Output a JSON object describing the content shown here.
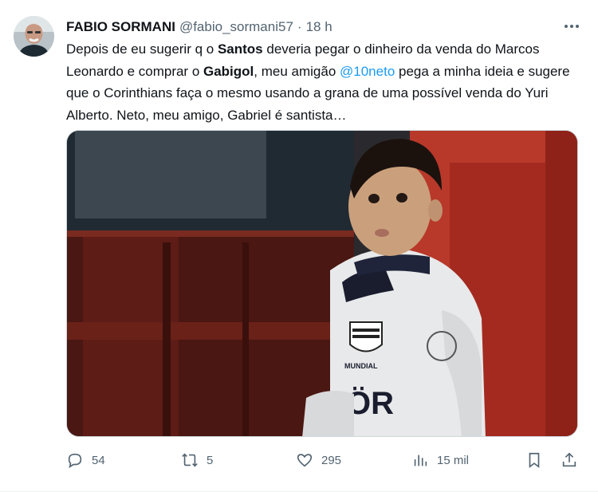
{
  "author": {
    "name": "FABIO SORMANI",
    "handle": "@fabio_sormani57",
    "separator": "·",
    "time": "18 h"
  },
  "tweet": {
    "segments": [
      {
        "t": "Depois de eu sugerir q o ",
        "style": "normal"
      },
      {
        "t": "Santos",
        "style": "bold"
      },
      {
        "t": " deveria pegar o dinheiro da venda do Marcos Leonardo e comprar o ",
        "style": "normal"
      },
      {
        "t": "Gabigol",
        "style": "bold"
      },
      {
        "t": ", meu amigão ",
        "style": "normal"
      },
      {
        "t": "@10neto",
        "style": "mention"
      },
      {
        "t": " pega a minha ideia e sugere que o Corinthians faça o mesmo usando a grana de uma possível venda do Yuri Alberto. Neto, meu amigo, Gabriel é santista…",
        "style": "normal"
      }
    ]
  },
  "media": {
    "shirt_text_mundial": "MUNDIAL",
    "shirt_text_sponsor": "ÖR"
  },
  "actions": {
    "replies": "54",
    "retweets": "5",
    "likes": "295",
    "views": "15 mil"
  },
  "icons": {
    "more": "more-horizontal-icon",
    "reply": "reply-icon",
    "retweet": "retweet-icon",
    "like": "heart-icon",
    "views": "views-chart-icon",
    "bookmark": "bookmark-icon",
    "share": "share-icon"
  },
  "colors": {
    "text": "#0f1419",
    "secondary": "#536471",
    "link": "#1d9bf0"
  }
}
